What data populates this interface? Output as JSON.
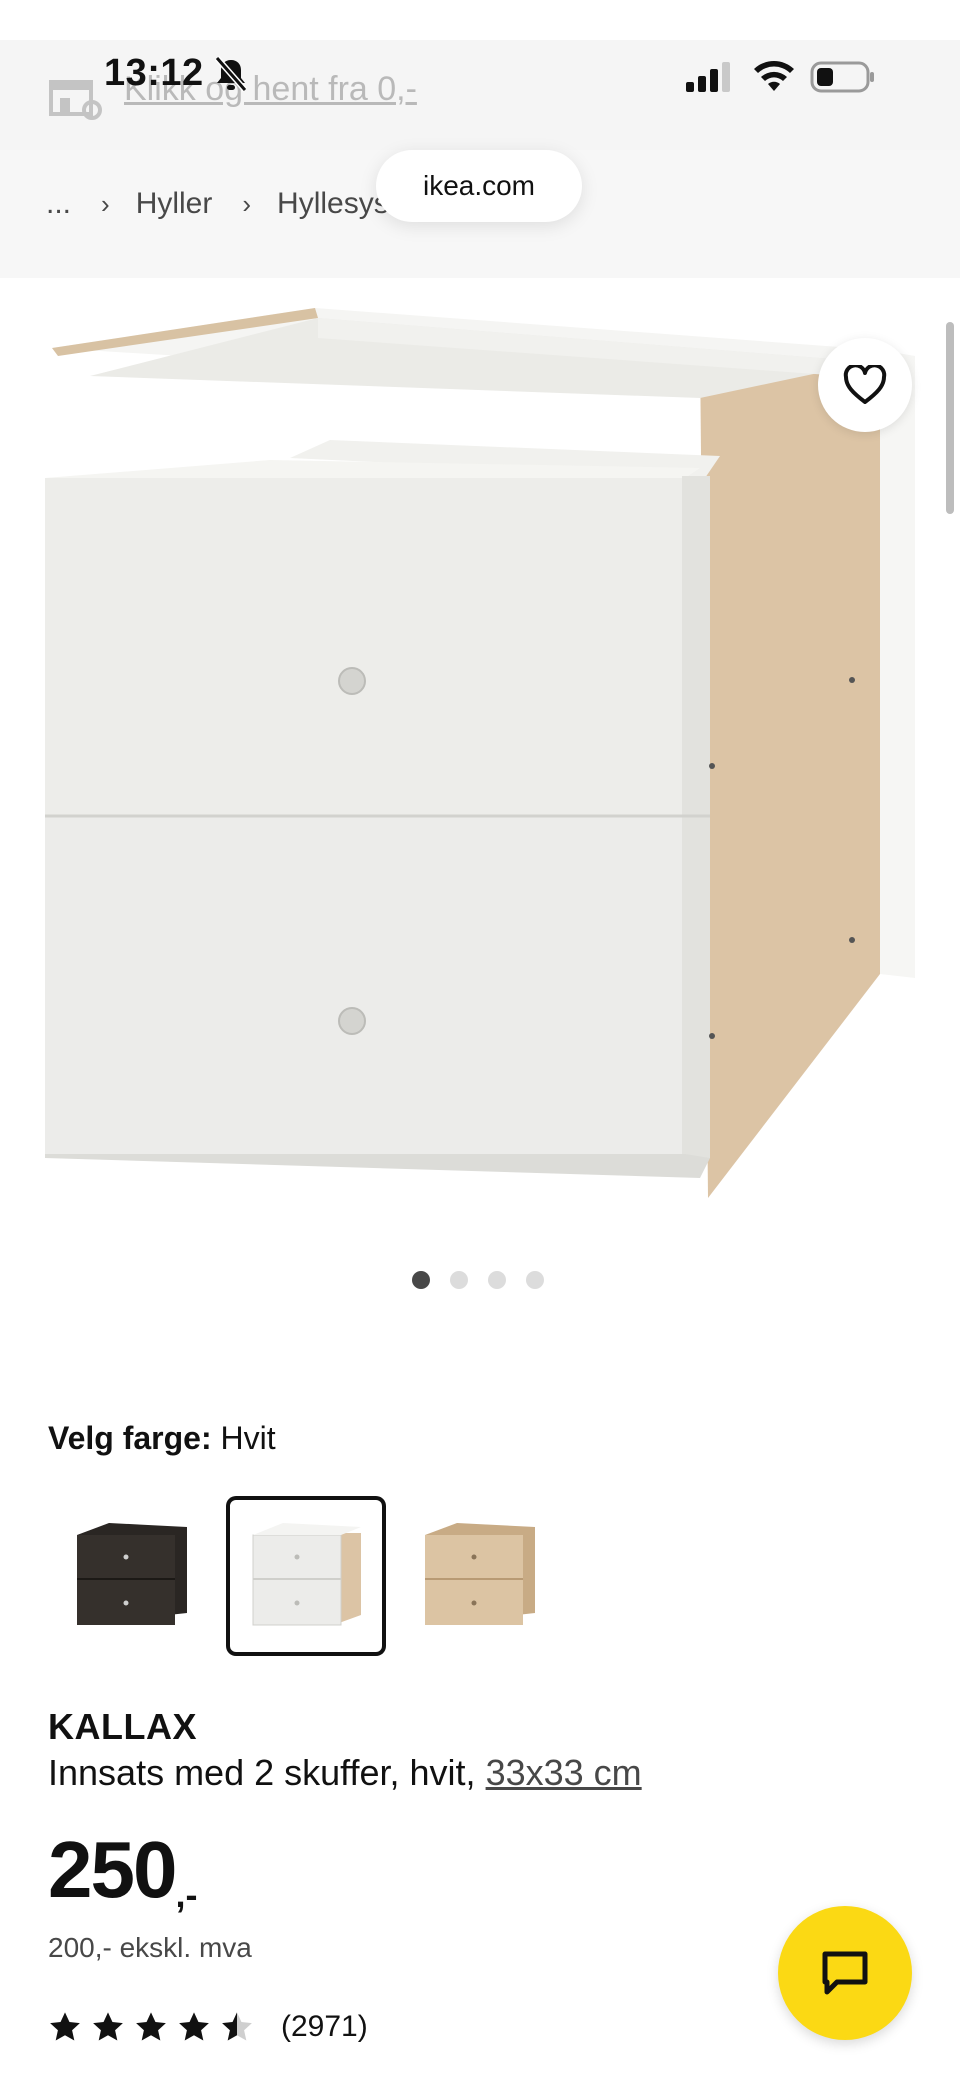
{
  "status_bar": {
    "time": "13:12"
  },
  "banner": {
    "click_collect": "Klikk og hent fra 0,-"
  },
  "browser": {
    "url": "ikea.com"
  },
  "breadcrumb": {
    "ellipsis": "...",
    "items": [
      "Hyller",
      "Hyllesyste"
    ]
  },
  "gallery": {
    "dots": 4,
    "active_index": 0
  },
  "color_picker": {
    "label": "Velg farge:",
    "selected": "Hvit",
    "swatches": [
      {
        "color": "black-brown",
        "selected": false
      },
      {
        "color": "white",
        "selected": true
      },
      {
        "color": "oak-effect",
        "selected": false
      }
    ]
  },
  "product": {
    "name": "KALLAX",
    "description": "Innsats med 2 skuffer, hvit,",
    "size_link": "33x33 cm",
    "price_int": "250",
    "price_suffix": ",-",
    "price_ex_vat": "200,- ekskl. mva",
    "rating": 4.5,
    "review_count": "(2971)"
  },
  "colors": {
    "accent_yellow": "#fbd914",
    "text": "#111111",
    "muted": "#484848"
  }
}
